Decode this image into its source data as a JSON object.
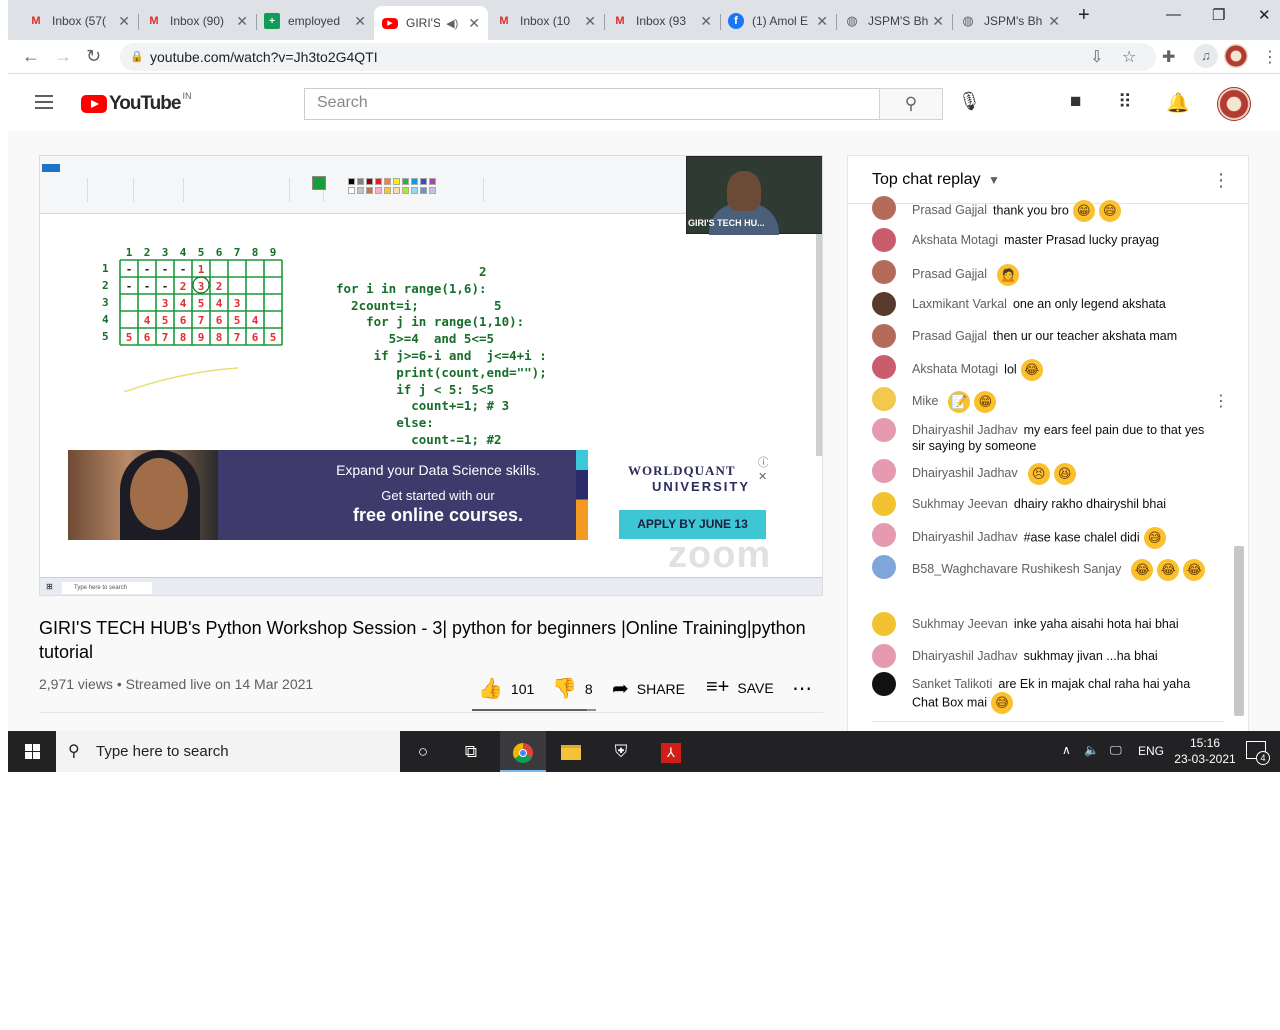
{
  "browser": {
    "tabs": [
      {
        "title": "Inbox (57(",
        "icon": "gmail"
      },
      {
        "title": "Inbox (90)",
        "icon": "gmail"
      },
      {
        "title": "employed",
        "icon": "sheets"
      },
      {
        "title": "GIRI'S",
        "icon": "youtube",
        "active": true
      },
      {
        "title": "Inbox (10",
        "icon": "gmail"
      },
      {
        "title": "Inbox (93",
        "icon": "gmail"
      },
      {
        "title": "(1) Amol E",
        "icon": "facebook"
      },
      {
        "title": "JSPM'S Bh",
        "icon": "globe"
      },
      {
        "title": "JSPM's Bh",
        "icon": "globe"
      }
    ],
    "url": "youtube.com/watch?v=Jh3to2G4QTI"
  },
  "youtube": {
    "logo_text": "YouTube",
    "region": "IN",
    "search_placeholder": "Search"
  },
  "video": {
    "camera_label": "GIRI'S TECH HU...",
    "code_lines": [
      "                   2",
      "for i in range(1,6):",
      "  2count=i;          5",
      "    for j in range(1,10):",
      "       5>=4  and 5<=5",
      "     if j>=6-i and  j<=4+i :",
      "        print(count,end=\"\");",
      "        if j < 5: 5<5",
      "          count+=1; # 3",
      "        else:",
      "          count-=1; #2"
    ],
    "grid_col_headers": [
      "1",
      "2",
      "3",
      "4",
      "5",
      "6",
      "7",
      "8",
      "9"
    ],
    "grid_row_headers": [
      "1",
      "2",
      "3",
      "4",
      "5"
    ],
    "grid_rows": [
      [
        "-",
        "-",
        "-",
        "-",
        "1",
        "",
        "",
        "",
        ""
      ],
      [
        "-",
        "-",
        "-",
        "2",
        "3",
        "2",
        "",
        "",
        ""
      ],
      [
        "",
        "",
        "3",
        "4",
        "5",
        "4",
        "3",
        "",
        ""
      ],
      [
        "",
        "4",
        "5",
        "6",
        "7",
        "6",
        "5",
        "4",
        ""
      ],
      [
        "5",
        "6",
        "7",
        "8",
        "9",
        "8",
        "7",
        "6",
        "5"
      ]
    ],
    "ad": {
      "line1": "Expand your Data Science skills.",
      "line2": "Get started with our",
      "line3": "free online courses.",
      "brand1": "WORLDQUANT",
      "brand2": "UNIVERSITY",
      "cta": "APPLY BY JUNE 13"
    },
    "watermark": "zoom",
    "inner_search": "Type here to search",
    "title": "GIRI'S TECH HUB's Python Workshop Session - 3| python for beginners |Online Training|python tutorial",
    "views": "2,971 views",
    "streamed": "Streamed live on 14 Mar 2021",
    "likes": "101",
    "dislikes": "8",
    "share_label": "SHARE",
    "save_label": "SAVE",
    "like_ratio": 0.93
  },
  "chat": {
    "header": "Top chat replay",
    "messages": [
      {
        "author": "Prasad Gajjal",
        "text": "thank you bro",
        "emoji": [
          "grin",
          "smile"
        ],
        "avatar": "#b46b5a"
      },
      {
        "author": "Akshata Motagi",
        "text": "master Prasad lucky prayag",
        "emoji": [],
        "avatar": "#c95d6e"
      },
      {
        "author": "Prasad Gajjal",
        "text": "",
        "emoji": [
          "person"
        ],
        "avatar": "#b46b5a"
      },
      {
        "author": "Laxmikant Varkal",
        "text": "one an only legend akshata",
        "emoji": [],
        "avatar": "#5a3a2c"
      },
      {
        "author": "Prasad Gajjal",
        "text": "then ur our teacher akshata mam",
        "emoji": [],
        "avatar": "#b46b5a"
      },
      {
        "author": "Akshata Motagi",
        "text": "lol",
        "emoji": [
          "joy"
        ],
        "avatar": "#c95d6e"
      },
      {
        "author": "Mike",
        "text": "",
        "emoji": [
          "memo",
          "grin"
        ],
        "avatar": "#f2c94c"
      },
      {
        "author": "Dhairyashil Jadhav",
        "text": "my ears feel pain due to that yes sir saying by someone",
        "emoji": [],
        "avatar": "#e59ab0"
      },
      {
        "author": "Dhairyashil Jadhav",
        "text": "",
        "emoji": [
          "persevere",
          "laugh"
        ],
        "avatar": "#e59ab0"
      },
      {
        "author": "Sukhmay Jeevan",
        "text": "dhairy rakho dhairyshil bhai",
        "emoji": [],
        "avatar": "#f2c230"
      },
      {
        "author": "Dhairyashil Jadhav",
        "text": "#ase kase chalel didi",
        "emoji": [
          "sweat"
        ],
        "avatar": "#e59ab0"
      },
      {
        "author": "B58_Waghchavare Rushikesh Sanjay",
        "text": "",
        "emoji": [
          "joy",
          "joy",
          "joy"
        ],
        "avatar": "#7fa6d8"
      },
      {
        "author": "Sukhmay Jeevan",
        "text": "inke yaha aisahi hota hai bhai",
        "emoji": [],
        "avatar": "#f2c230"
      },
      {
        "author": "Dhairyashil Jadhav",
        "text": "sukhmay jivan ...ha bhai",
        "emoji": [],
        "avatar": "#e59ab0"
      },
      {
        "author": "Sanket Talikoti",
        "text": "are Ek in majak chal raha hai yaha Chat Box mai",
        "emoji": [
          "sweat"
        ],
        "avatar": "#111111"
      }
    ]
  },
  "taskbar": {
    "search_placeholder": "Type here to search",
    "language": "ENG",
    "time": "15:16",
    "date": "23-03-2021",
    "notifications": "4"
  }
}
